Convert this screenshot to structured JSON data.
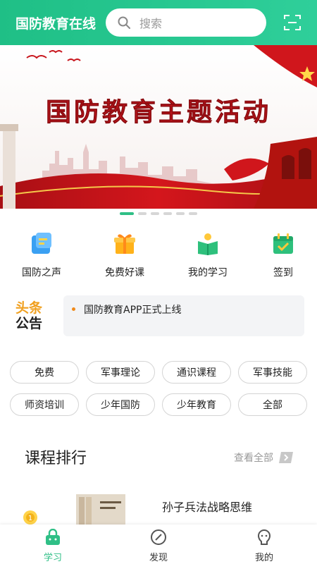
{
  "header": {
    "app_title": "国防教育在线",
    "search_placeholder": "搜索"
  },
  "banner": {
    "headline": "国防教育主题活动",
    "slide_count": 6,
    "active_slide": 1
  },
  "quick_links": [
    {
      "label": "国防之声",
      "icon": "broadcast-icon"
    },
    {
      "label": "免费好课",
      "icon": "gift-icon"
    },
    {
      "label": "我的学习",
      "icon": "study-book-icon"
    },
    {
      "label": "签到",
      "icon": "checkin-calendar-icon"
    }
  ],
  "notice": {
    "logo_line1": "头条",
    "logo_line2": "公告",
    "text": "国防教育APP正式上线"
  },
  "tags": [
    "免费",
    "军事理论",
    "通识课程",
    "军事技能",
    "师资培训",
    "少年国防",
    "少年教育",
    "全部"
  ],
  "ranking": {
    "title": "课程排行",
    "more_label": "查看全部",
    "first_course": {
      "title": "孙子兵法战略思维",
      "rank": "1"
    }
  },
  "tabbar": [
    {
      "label": "学习",
      "icon": "study-bag-icon",
      "active": true
    },
    {
      "label": "发现",
      "icon": "compass-icon",
      "active": false
    },
    {
      "label": "我的",
      "icon": "profile-icon",
      "active": false
    }
  ],
  "colors": {
    "brand": "#2fbf86",
    "notice_dot": "#f08a1a",
    "banner_red": "#c8161d"
  }
}
